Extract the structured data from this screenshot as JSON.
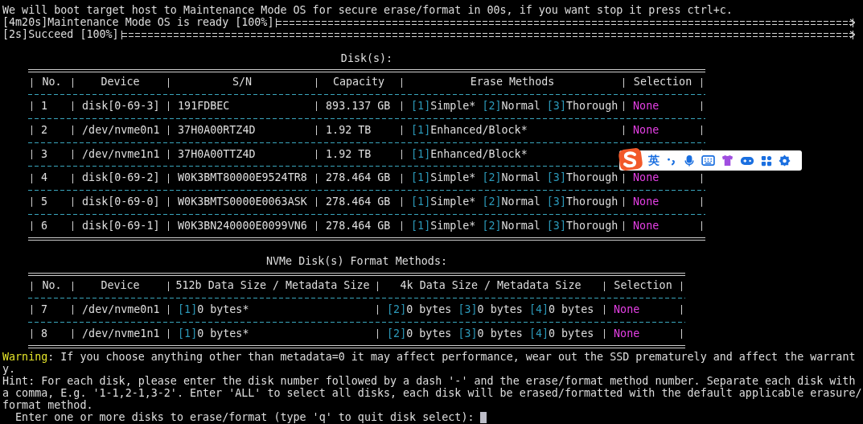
{
  "intro": "We will boot target host to Maintenance Mode OS for secure erase/format in 00s, if you want stop it press ctrl+c.",
  "progress": [
    {
      "label": "[4m20s]Maintenance Mode OS is ready [100%]",
      "level": 1
    },
    {
      "label": "[2s]Succeed [100%]",
      "level": 1
    }
  ],
  "disks": {
    "title": "Disk(s):",
    "columns": [
      "No.",
      "Device",
      "S/N",
      "Capacity",
      "Erase Methods",
      "Selection"
    ],
    "rows": [
      {
        "no": "1",
        "device": "disk[0-69-3]",
        "sn": "191FDBEC",
        "capacity": "893.137 GB",
        "methods": [
          {
            "key": "[1]",
            "name": "Simple*"
          },
          {
            "key": "[2]",
            "name": "Normal"
          },
          {
            "key": "[3]",
            "name": "Thorough"
          }
        ],
        "selection": "None"
      },
      {
        "no": "2",
        "device": "/dev/nvme0n1",
        "sn": "37H0A00RTZ4D",
        "capacity": "1.92 TB",
        "methods": [
          {
            "key": "[1]",
            "name": "Enhanced/Block*"
          }
        ],
        "selection": "None"
      },
      {
        "no": "3",
        "device": "/dev/nvme1n1",
        "sn": "37H0A00TTZ4D",
        "capacity": "1.92 TB",
        "methods": [
          {
            "key": "[1]",
            "name": "Enhanced/Block*"
          }
        ]
      },
      {
        "no": "4",
        "device": "disk[0-69-2]",
        "sn": "W0K3BMT80000E9524TR8",
        "capacity": "278.464 GB",
        "methods": [
          {
            "key": "[1]",
            "name": "Simple*"
          },
          {
            "key": "[2]",
            "name": "Normal"
          },
          {
            "key": "[3]",
            "name": "Thorough"
          }
        ],
        "selection": "None"
      },
      {
        "no": "5",
        "device": "disk[0-69-0]",
        "sn": "W0K3BMTS0000E0063ASK",
        "capacity": "278.464 GB",
        "methods": [
          {
            "key": "[1]",
            "name": "Simple*"
          },
          {
            "key": "[2]",
            "name": "Normal"
          },
          {
            "key": "[3]",
            "name": "Thorough"
          }
        ],
        "selection": "None"
      },
      {
        "no": "6",
        "device": "disk[0-69-1]",
        "sn": "W0K3BN240000E0099VN6",
        "capacity": "278.464 GB",
        "methods": [
          {
            "key": "[1]",
            "name": "Simple*"
          },
          {
            "key": "[2]",
            "name": "Normal"
          },
          {
            "key": "[3]",
            "name": "Thorough"
          }
        ],
        "selection": "None"
      }
    ]
  },
  "nvme": {
    "title": "NVMe Disk(s) Format Methods:",
    "columns": [
      "No.",
      "Device",
      "512b Data Size / Metadata Size",
      "4k Data Size / Metadata Size",
      "Selection"
    ],
    "rows": [
      {
        "no": "7",
        "device": "/dev/nvme0n1",
        "format_512b": [
          {
            "key": "[1]",
            "name": "0 bytes*"
          }
        ],
        "format_4k": [
          {
            "key": "[2]",
            "name": "0 bytes"
          },
          {
            "key": "[3]",
            "name": "0 bytes"
          },
          {
            "key": "[4]",
            "name": "0 bytes"
          }
        ],
        "selection": "None"
      },
      {
        "no": "8",
        "device": "/dev/nvme1n1",
        "format_512b": [
          {
            "key": "[1]",
            "name": "0 bytes*"
          }
        ],
        "format_4k": [
          {
            "key": "[2]",
            "name": "0 bytes"
          },
          {
            "key": "[3]",
            "name": "0 bytes"
          },
          {
            "key": "[4]",
            "name": "0 bytes"
          }
        ],
        "selection": "None"
      }
    ]
  },
  "warning": {
    "label": "Warning",
    "text": ": If you choose anything other than metadata=0 it may affect performance, wear out the SSD prematurely and affect the warranty."
  },
  "hint": "Hint: For each disk, please enter the disk number followed by a dash '-' and the erase/format method number. Separate each disk with a comma, E.g. '1-1,2-1,3-2'. Enter 'ALL' to select all disks, each disk will be erased/formatted with the default applicable erasure/format method.",
  "prompt": "Enter one or more disks to erase/format (type 'q' to quit disk select):",
  "ime_toolbar": {
    "mode": "英"
  }
}
